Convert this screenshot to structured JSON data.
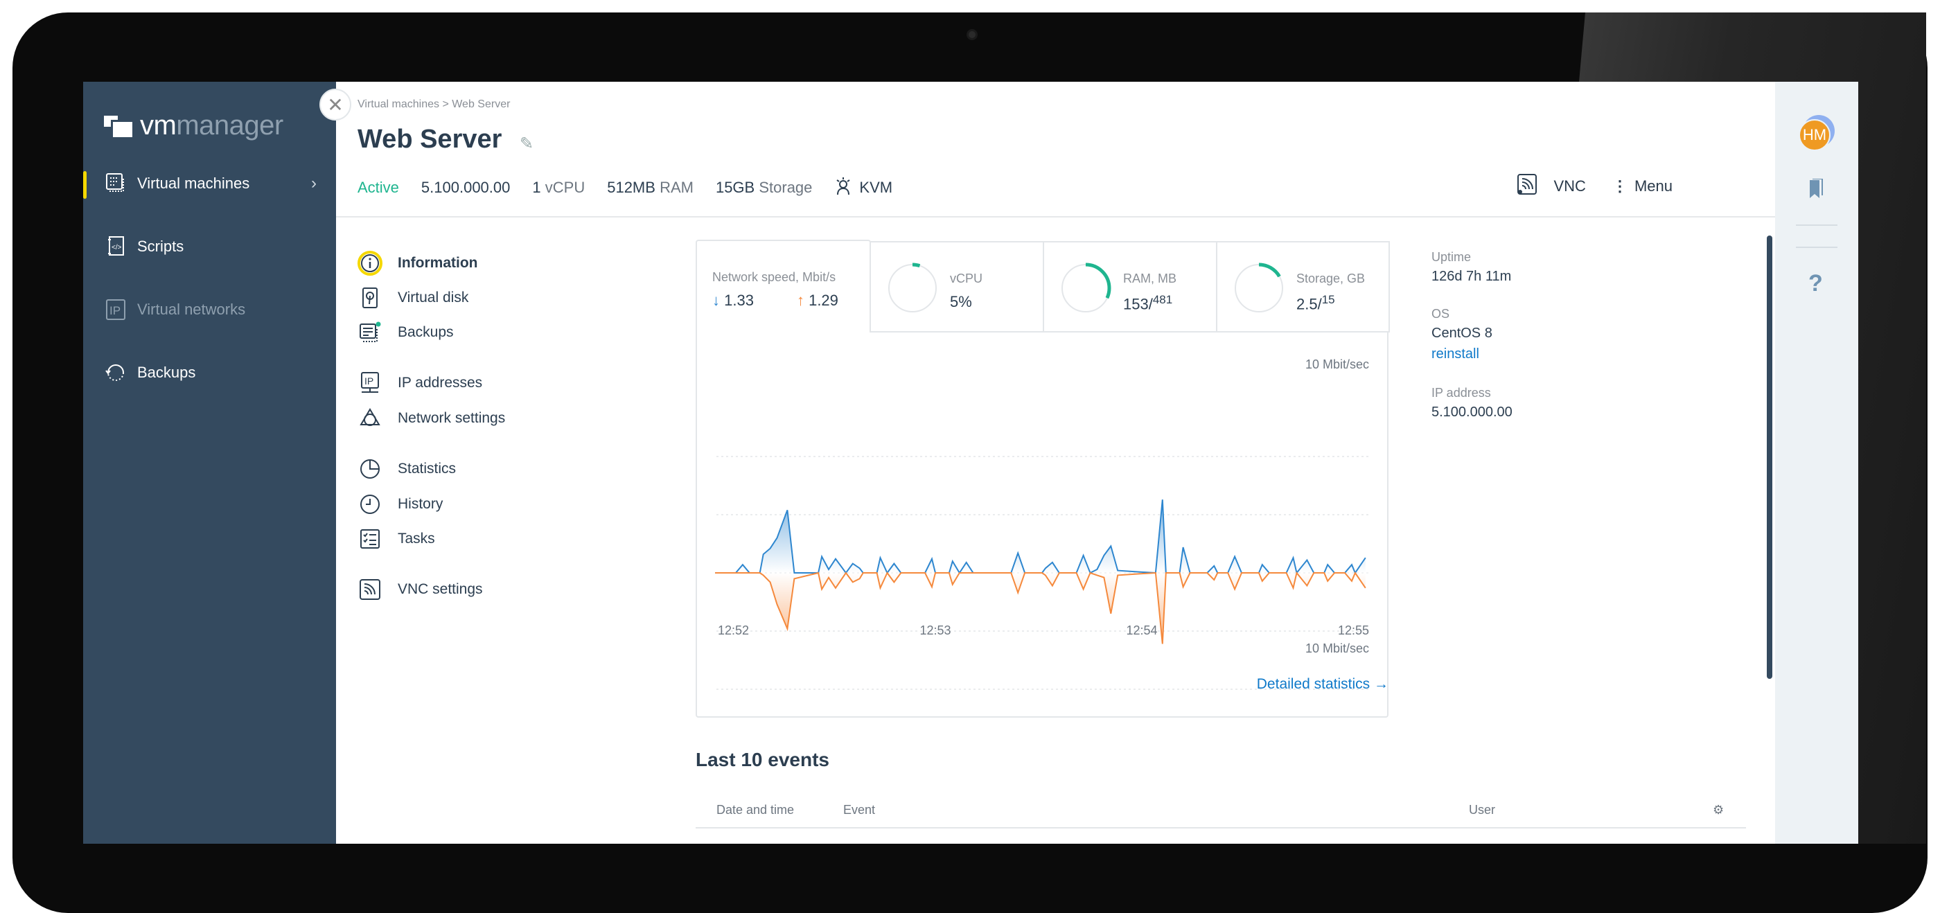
{
  "app": {
    "logo_bold": "vm",
    "logo_light": "manager"
  },
  "sidebar": {
    "items": [
      {
        "label": "Virtual machines",
        "icon": "server-icon",
        "active": true
      },
      {
        "label": "Scripts",
        "icon": "script-icon"
      },
      {
        "label": "Virtual networks",
        "icon": "ip-icon",
        "disabled": true
      },
      {
        "label": "Backups",
        "icon": "backup-icon"
      }
    ]
  },
  "header": {
    "breadcrumb": [
      "Virtual machines",
      ">",
      "Web Server"
    ],
    "title": "Web Server",
    "status": "Active",
    "ip": "5.100.000.00",
    "vcpu_num": "1",
    "vcpu_unit": "vCPU",
    "ram_num": "512MB",
    "ram_unit": "RAM",
    "storage_num": "15GB",
    "storage_unit": "Storage",
    "hypervisor": "KVM",
    "vnc_label": "VNC",
    "menu_label": "Menu"
  },
  "subnav": [
    {
      "label": "Information",
      "icon": "info-icon",
      "active": true
    },
    {
      "label": "Virtual disk",
      "icon": "disk-icon"
    },
    {
      "label": "Backups",
      "icon": "backup-server-icon"
    },
    {
      "label": "IP addresses",
      "icon": "ip-address-icon"
    },
    {
      "label": "Network settings",
      "icon": "network-icon"
    },
    {
      "label": "Statistics",
      "icon": "pie-chart-icon"
    },
    {
      "label": "History",
      "icon": "clock-icon"
    },
    {
      "label": "Tasks",
      "icon": "tasks-icon"
    },
    {
      "label": "VNC settings",
      "icon": "vnc-icon"
    }
  ],
  "metrics": {
    "network": {
      "label": "Network speed, Mbit/s",
      "down": "1.33",
      "up": "1.29"
    },
    "vcpu": {
      "label": "vCPU",
      "value": "5%",
      "percent": 5
    },
    "ram": {
      "label": "RAM, MB",
      "used": "153/",
      "total": "481",
      "fraction": 0.318
    },
    "storage": {
      "label": "Storage, GB",
      "used": "2.5/",
      "total": "15",
      "fraction": 0.167
    }
  },
  "colors": {
    "download": "#2d86cf",
    "upload": "#f5893c",
    "accent": "#1fb58f",
    "sidebar": "#344a5f",
    "highlight": "#f5d800",
    "avatar": "#ef9a22"
  },
  "chart_data": {
    "type": "area",
    "top_label": "10 Mbit/sec",
    "bottom_label": "10 Mbit/sec",
    "ylim": [
      -10,
      10
    ],
    "grid": true,
    "x_ticks": [
      "12:52",
      "12:53",
      "12:54",
      "12:55"
    ],
    "x": [
      "12:51:56",
      "12:52:02",
      "12:52:04",
      "12:52:06",
      "12:52:09",
      "12:52:10",
      "12:52:12",
      "12:52:14",
      "12:52:17",
      "12:52:19",
      "12:52:26",
      "12:52:27",
      "12:52:29",
      "12:52:31",
      "12:52:34",
      "12:52:36",
      "12:52:38",
      "12:52:39",
      "12:52:43",
      "12:52:44",
      "12:52:46",
      "12:52:48",
      "12:52:50",
      "12:52:57",
      "12:52:59",
      "12:53:00",
      "12:53:04",
      "12:53:05",
      "12:53:07",
      "12:53:09",
      "12:53:11",
      "12:53:22",
      "12:53:24",
      "12:53:26",
      "12:53:31",
      "12:53:32",
      "12:53:34",
      "12:53:36",
      "12:53:41",
      "12:53:43",
      "12:53:45",
      "12:53:47",
      "12:53:49",
      "12:53:51",
      "12:53:53",
      "12:53:58",
      "12:54:04",
      "12:54:06",
      "12:54:07",
      "12:54:11",
      "12:54:12",
      "12:54:14",
      "12:54:19",
      "12:54:21",
      "12:54:22",
      "12:54:25",
      "12:54:27",
      "12:54:29",
      "12:54:34",
      "12:54:35",
      "12:54:37",
      "12:54:42",
      "12:54:44",
      "12:54:45",
      "12:54:48",
      "12:54:50",
      "12:54:53",
      "12:54:54",
      "12:54:56",
      "12:54:59",
      "12:55:01",
      "12:55:02",
      "12:55:05"
    ],
    "series": [
      {
        "direction": "down",
        "color": "#2d86cf",
        "values": [
          0,
          0,
          0.7,
          0,
          0,
          1.6,
          2.1,
          3.0,
          5.4,
          0,
          0,
          1.4,
          0.3,
          1.2,
          0,
          0.8,
          0.4,
          0,
          0,
          1.3,
          0,
          0.8,
          0,
          0,
          1.2,
          0,
          0,
          1.0,
          0,
          0.9,
          0,
          0,
          1.7,
          0,
          0,
          0.4,
          0.9,
          0,
          0,
          1.5,
          0,
          0.3,
          1.5,
          2.3,
          0.2,
          0.1,
          0,
          6.3,
          0,
          0,
          2.2,
          0,
          0,
          0.6,
          0,
          0,
          1.4,
          0,
          0,
          0.7,
          0,
          0,
          1.3,
          0,
          1.1,
          0,
          0,
          0.7,
          0,
          0,
          0.7,
          0,
          1.3
        ]
      },
      {
        "direction": "up",
        "color": "#f5893c",
        "values": [
          0,
          0,
          0,
          0,
          0,
          0.2,
          0.8,
          2.7,
          4.8,
          0.5,
          0,
          1.4,
          0.4,
          1.3,
          0,
          0.8,
          0.5,
          0,
          0,
          1.3,
          0,
          0.8,
          0,
          0,
          1.2,
          0,
          0,
          1.0,
          0,
          0,
          0,
          0,
          1.7,
          0,
          0,
          0.2,
          1.1,
          0,
          0,
          1.4,
          0,
          0.2,
          0.4,
          3.5,
          0.2,
          0.1,
          0,
          6.1,
          0,
          0,
          1.2,
          0,
          0,
          0.6,
          0,
          0,
          1.4,
          0,
          0,
          0.7,
          0,
          0,
          1.3,
          0,
          1.1,
          0,
          0,
          0.7,
          0,
          0,
          0.7,
          0,
          1.3
        ]
      }
    ]
  },
  "detailed_link": "Detailed statistics →",
  "info": {
    "uptime_label": "Uptime",
    "uptime": "126d 7h 11m",
    "os_label": "OS",
    "os": "CentOS 8",
    "reinstall": "reinstall",
    "ip_label": "IP address",
    "ip": "5.100.000.00"
  },
  "events": {
    "title": "Last 10 events",
    "columns": [
      "Date and time",
      "Event",
      "User"
    ]
  },
  "rail": {
    "avatar": "HM"
  }
}
